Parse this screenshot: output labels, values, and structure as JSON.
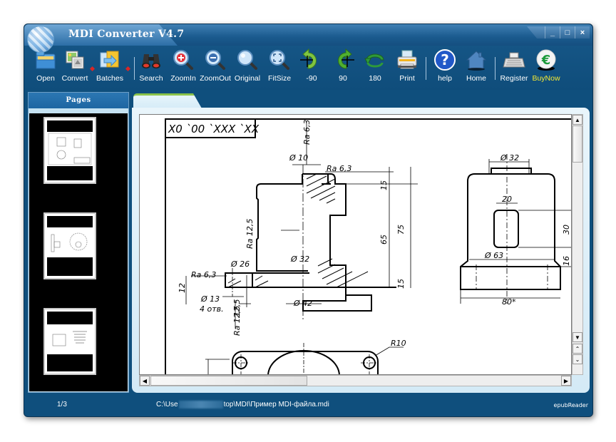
{
  "window": {
    "title": "MDI Converter V4.7",
    "controls": {
      "minimize": "_",
      "maximize": "□",
      "close": "×"
    }
  },
  "toolbar": {
    "items": [
      {
        "id": "open",
        "label": "Open",
        "icon": "folder-open-icon"
      },
      {
        "id": "convert",
        "label": "Convert",
        "icon": "image-convert-icon",
        "dropdown": true
      },
      {
        "id": "batches",
        "label": "Batches",
        "icon": "batch-folder-icon",
        "dropdown": true
      },
      {
        "id": "search",
        "label": "Search",
        "icon": "binoculars-icon"
      },
      {
        "id": "zoomin",
        "label": "ZoomIn",
        "icon": "zoom-in-icon"
      },
      {
        "id": "zoomout",
        "label": "ZoomOut",
        "icon": "zoom-out-icon"
      },
      {
        "id": "original",
        "label": "Original",
        "icon": "magnifier-icon"
      },
      {
        "id": "fitsize",
        "label": "FitSize",
        "icon": "fit-size-icon"
      },
      {
        "id": "rotate-left",
        "label": "-90",
        "icon": "rotate-left-icon"
      },
      {
        "id": "rotate-right",
        "label": "90",
        "icon": "rotate-right-icon"
      },
      {
        "id": "rotate-180",
        "label": "180",
        "icon": "rotate-180-icon"
      },
      {
        "id": "print",
        "label": "Print",
        "icon": "printer-icon"
      },
      {
        "id": "help",
        "label": "help",
        "icon": "help-icon"
      },
      {
        "id": "home",
        "label": "Home",
        "icon": "home-icon"
      },
      {
        "id": "register",
        "label": "Register",
        "icon": "cash-register-icon"
      },
      {
        "id": "buynow",
        "label": "BuyNow",
        "icon": "euro-coin-icon"
      }
    ]
  },
  "pages_panel": {
    "title": "Pages",
    "thumbnails": [
      {
        "page": 1,
        "selected": true
      },
      {
        "page": 2,
        "selected": false
      },
      {
        "page": 3,
        "selected": false
      }
    ]
  },
  "drawing": {
    "title_block": "X0 `00 `XXX `XX",
    "annotations": {
      "ra_top": "Ra 6,3",
      "d10": "Ø 10",
      "ra_top2": "Ra 6,3",
      "ra_left": "Ra 12,5",
      "d26": "Ø 26",
      "ra_flange": "Ra 6,3",
      "d32": "Ø 32",
      "dim15a": "15",
      "dim65": "65",
      "dim75": "75",
      "dim15b": "15",
      "dim12": "12",
      "d13": "Ø 13",
      "holes": "4 отв.",
      "d42": "Ø 42",
      "dim12_5": "12,5",
      "ra_bottom": "Ra 12,5",
      "r10": "R10",
      "side_d32": "Ø 32",
      "side_20": "20",
      "side_30": "30",
      "side_d63": "Ø 63",
      "side_16": "16",
      "side_80": "80*"
    }
  },
  "status": {
    "page": "1/3",
    "path_start": "C:\\Use",
    "path_end": "top\\MDI\\Пример MDI-файла.mdi",
    "brand": "epubReader"
  }
}
